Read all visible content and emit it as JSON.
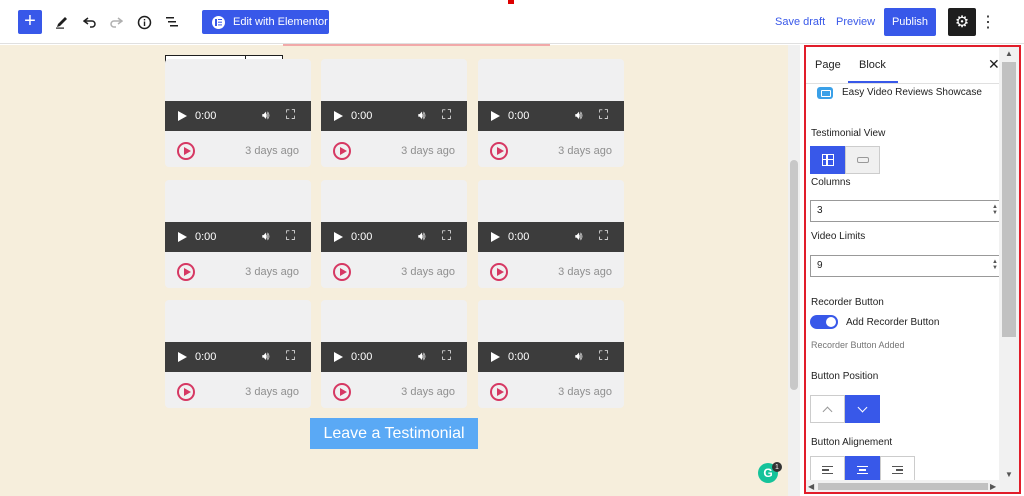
{
  "toolbar": {
    "elementor_label": "Edit with Elementor",
    "save_draft": "Save draft",
    "preview": "Preview",
    "publish": "Publish"
  },
  "cards": [
    {
      "time": "0:00",
      "date": "3 days ago"
    },
    {
      "time": "0:00",
      "date": "3 days ago"
    },
    {
      "time": "0:00",
      "date": "3 days ago"
    },
    {
      "time": "0:00",
      "date": "3 days ago"
    },
    {
      "time": "0:00",
      "date": "3 days ago"
    },
    {
      "time": "0:00",
      "date": "3 days ago"
    },
    {
      "time": "0:00",
      "date": "3 days ago"
    },
    {
      "time": "0:00",
      "date": "3 days ago"
    },
    {
      "time": "0:00",
      "date": "3 days ago"
    }
  ],
  "leave_button": "Leave a Testimonial",
  "grammarly": {
    "letter": "G",
    "badge": "1"
  },
  "sidebar": {
    "tabs": [
      "Page",
      "Block"
    ],
    "active_tab": "Block",
    "plugin_name": "Easy Video Reviews Showcase",
    "testimonial_view_label": "Testimonial View",
    "testimonial_view_selected": "grid",
    "columns_label": "Columns",
    "columns_value": "3",
    "video_limits_label": "Video Limits",
    "video_limits_value": "9",
    "recorder_button_label": "Recorder Button",
    "recorder_toggle_label": "Add Recorder Button",
    "recorder_toggle_on": true,
    "recorder_help": "Recorder Button Added",
    "button_position_label": "Button Position",
    "button_position_selected": "down",
    "button_alignment_label": "Button Alignement",
    "button_alignment_selected": "center"
  },
  "colors": {
    "accent": "#3858e9",
    "highlight_border": "#e11d2a",
    "canvas_bg": "#f6eedc",
    "card_play": "#d63863",
    "leave_button": "#5aa9f5"
  }
}
